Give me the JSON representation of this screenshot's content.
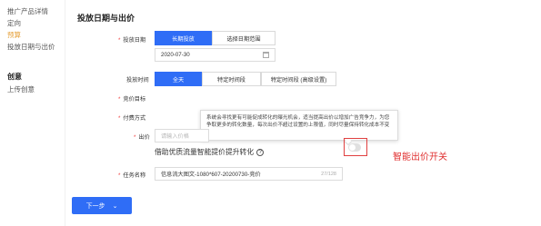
{
  "sidebar": {
    "items": [
      {
        "label": "推广产品详情"
      },
      {
        "label": "定向"
      },
      {
        "label": "预算"
      },
      {
        "label": "投放日期与出价"
      }
    ],
    "group_title": "创意",
    "group_items": [
      {
        "label": "上传创意"
      }
    ]
  },
  "section": {
    "title": "投放日期与出价"
  },
  "schedule_date": {
    "label": "投放日期",
    "options": [
      "长期投放",
      "选择日期范围"
    ],
    "selected": "长期投放",
    "date_value": "2020-07-30"
  },
  "schedule_time": {
    "label": "投放时间",
    "options": [
      "全天",
      "特定时间段",
      "特定时间段 (高级设置)"
    ],
    "selected": "全天"
  },
  "bid_target": {
    "label": "竞价目标"
  },
  "pay_method": {
    "label": "付费方式"
  },
  "bid": {
    "label": "出价",
    "placeholder": "请输入价格"
  },
  "tooltip": {
    "text": "系统会寻找更有可能促成转化的曝光机会，适当提高出价以增加广告竞争力，为您争取更多的转化数量，每次出价不超过设置的上限值，同时尽量保持转化成本不变"
  },
  "smart_bid": {
    "label": "借助优质流量智能提价提升转化",
    "enabled": false
  },
  "annotation": {
    "text": "智能出价开关"
  },
  "task_name": {
    "label": "任务名称",
    "value": "信息流大图文-1080*607-20200730-竞价",
    "counter": "27/128"
  },
  "footer": {
    "next_label": "下一步"
  },
  "colors": {
    "primary": "#2f6df6",
    "required": "#f04040",
    "annotation": "#e03030",
    "active_nav": "#e6a23c"
  }
}
